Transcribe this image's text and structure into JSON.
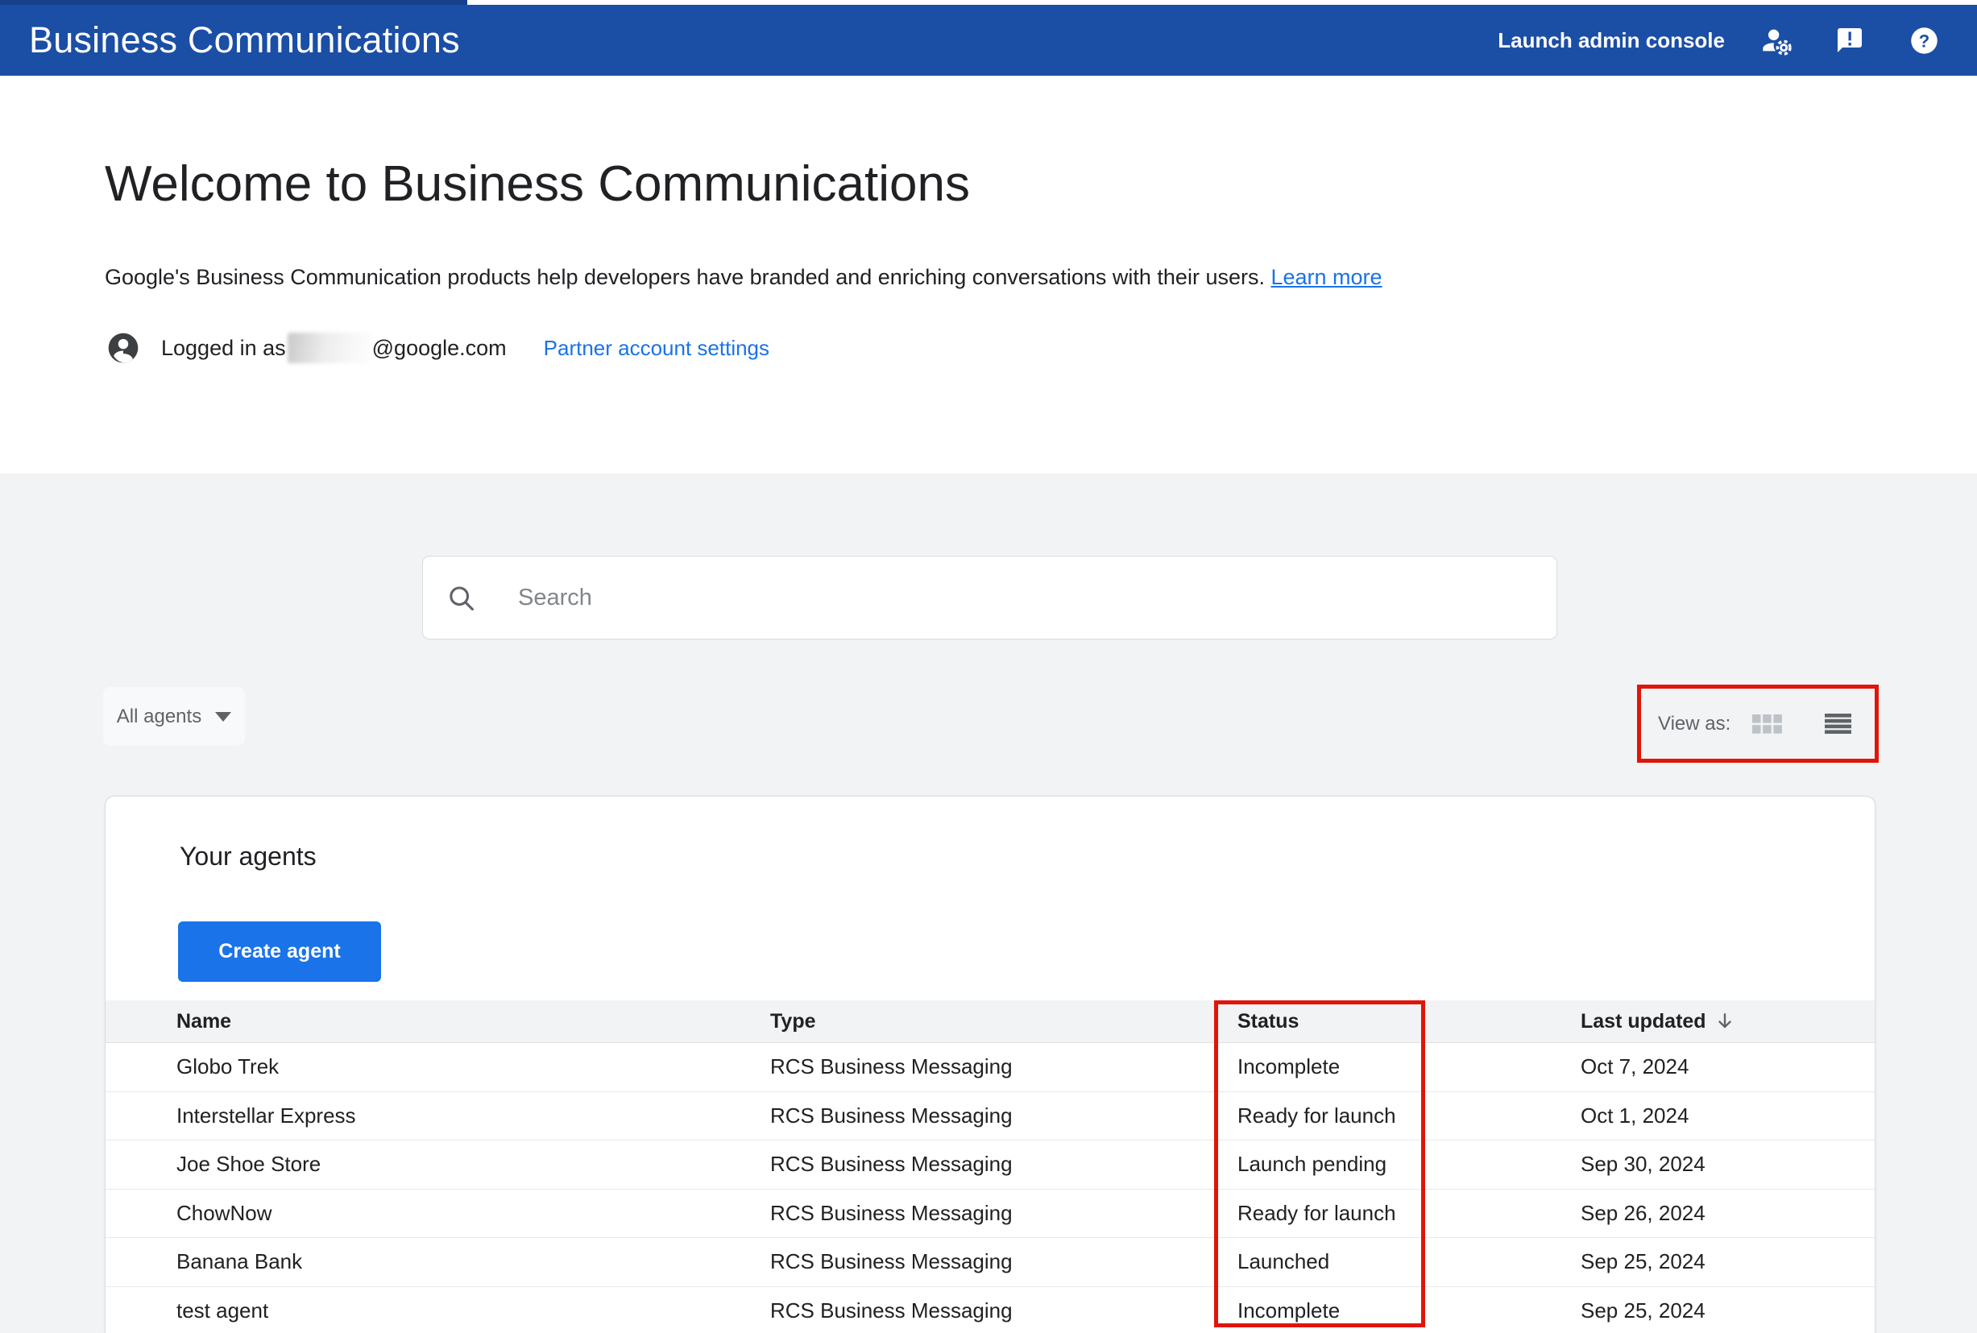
{
  "header": {
    "title": "Business Communications",
    "launch_admin_console": "Launch admin console"
  },
  "welcome": {
    "heading": "Welcome to Business Communications",
    "description": "Google's Business Communication products help developers have branded and enriching conversations with their users.",
    "learn_more_label": "Learn more",
    "logged_in_prefix": "Logged in as",
    "logged_in_domain": "@google.com",
    "partner_settings_label": "Partner account settings"
  },
  "toolbar": {
    "search_placeholder": "Search",
    "filter_label": "All agents",
    "view_as_label": "View as:"
  },
  "agents": {
    "title": "Your agents",
    "create_button_label": "Create agent",
    "columns": [
      "Name",
      "Type",
      "Status",
      "Last updated"
    ],
    "sorted_by": "Last updated",
    "sort_direction": "descending",
    "rows": [
      {
        "name": "Globo Trek",
        "type": "RCS Business Messaging",
        "status": "Incomplete",
        "updated": "Oct 7, 2024"
      },
      {
        "name": "Interstellar Express",
        "type": "RCS Business Messaging",
        "status": "Ready for launch",
        "updated": "Oct 1, 2024"
      },
      {
        "name": "Joe Shoe Store",
        "type": "RCS Business Messaging",
        "status": "Launch pending",
        "updated": "Sep 30, 2024"
      },
      {
        "name": "ChowNow",
        "type": "RCS Business Messaging",
        "status": "Ready for launch",
        "updated": "Sep 26, 2024"
      },
      {
        "name": "Banana Bank",
        "type": "RCS Business Messaging",
        "status": "Launched",
        "updated": "Sep 25, 2024"
      },
      {
        "name": "test agent",
        "type": "RCS Business Messaging",
        "status": "Incomplete",
        "updated": "Sep 25, 2024"
      }
    ]
  },
  "icons": [
    "manage-accounts-icon",
    "feedback-icon",
    "help-icon",
    "account-circle-icon",
    "search-icon",
    "dropdown-caret-icon",
    "grid-view-icon",
    "list-view-icon",
    "sort-descending-icon"
  ],
  "colors": {
    "header_bg": "#1b4ea5",
    "header_artifact": "#15418c",
    "accent_blue": "#1a73e8",
    "section_bg": "#f1f3f4",
    "table_header_bg": "#f1f3f4",
    "row_border": "#e7e9eb",
    "text_primary": "#202124",
    "text_secondary": "#5f6368",
    "annotation_red": "#e11507",
    "grid_icon_gray": "#bdc2c7"
  }
}
